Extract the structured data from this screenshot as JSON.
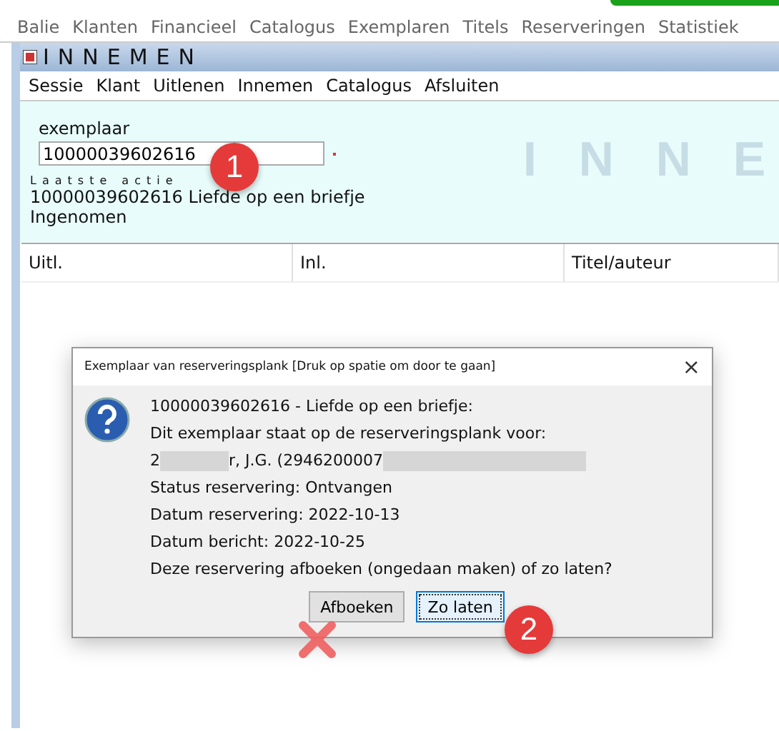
{
  "top_menu": [
    "Balie",
    "Klanten",
    "Financieel",
    "Catalogus",
    "Exemplaren",
    "Titels",
    "Reserveringen",
    "Statistiek"
  ],
  "window": {
    "title": "INNEMEN",
    "menu": [
      "Sessie",
      "Klant",
      "Uitlenen",
      "Innemen",
      "Catalogus",
      "Afsluiten"
    ],
    "field": {
      "label": "exemplaar",
      "value": "10000039602616"
    },
    "watermark": "I N N E",
    "last_action": {
      "heading": "Laatste actie",
      "lines": [
        "10000039602616 Liefde op een briefje",
        "Ingenomen"
      ]
    },
    "table": {
      "columns": [
        "Uitl.",
        "Inl.",
        "Titel/auteur"
      ]
    }
  },
  "dialog": {
    "title": "Exemplaar van reserveringsplank [Druk op spatie om door te gaan]",
    "close": "×",
    "lines": [
      {
        "kind": "text",
        "text": "10000039602616 - Liefde op een briefje:"
      },
      {
        "kind": "text",
        "text": "Dit exemplaar staat op de reserveringsplank voor:"
      },
      {
        "kind": "redacted",
        "parts": [
          "2",
          "r, J.G. (2946200007"
        ]
      },
      {
        "kind": "text",
        "text": "Status reservering: Ontvangen"
      },
      {
        "kind": "text",
        "text": "Datum reservering: 2022-10-13"
      },
      {
        "kind": "text",
        "text": "Datum bericht: 2022-10-25"
      },
      {
        "kind": "text",
        "text": "Deze reservering afboeken (ongedaan maken) of zo laten?"
      }
    ],
    "buttons": [
      {
        "label": "Afboeken",
        "selected": false
      },
      {
        "label": "Zo laten",
        "selected": true
      }
    ]
  },
  "callouts": [
    "1",
    "2"
  ]
}
